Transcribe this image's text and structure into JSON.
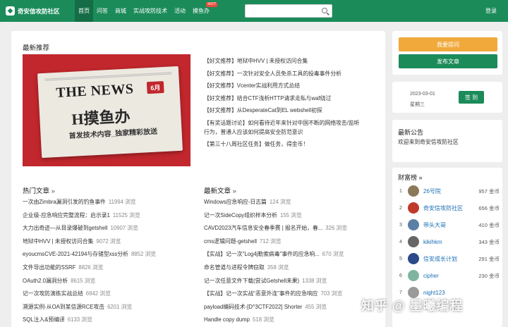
{
  "nav": {
    "logo": "奇安信攻防社区",
    "links": [
      "首页",
      "问答",
      "商城",
      "实战攻防技术",
      "活动",
      "摸鱼办"
    ],
    "hot_badge": "HOT",
    "search_placeholder": "",
    "login": "登录"
  },
  "recommend": {
    "title": "最新推荐",
    "banner": {
      "big": "THE NEWS",
      "month": "6月",
      "headline": "H摸鱼办",
      "sub": "首发技术内容_独家精彩放送"
    },
    "items": [
      "【好文推荐】地狱中HVV | 未授权访问合集",
      "【好文推荐】一次针对安全人员免杀工具的投毒事件分析",
      "【好文推荐】Vcenter实战利用方式总结",
      "【好文推荐】结合CTF浅析HTTP请求走私与waf绕过",
      "【好文推荐】从DesperateCat到EL webshell初探",
      "【有奖话题讨论】如何看待近年来针对中国不断的网络攻击/监听行为，普通人应该如何提高安全防范意识",
      "【第三十八周社区任务】做任务，得金币！"
    ]
  },
  "hot": {
    "title": "热门文章",
    "more": "»",
    "items": [
      {
        "title": "一次由Zimbra漏洞引发的钓鱼事件",
        "views": "11994 浏览"
      },
      {
        "title": "企业级-应急响应完整流程：启示录1",
        "views": "11525 浏览"
      },
      {
        "title": "大力出奇迹—从目录爆破到getshell",
        "views": "10907 浏览"
      },
      {
        "title": "地狱中HVV | 未授权访问合集",
        "views": "9072 浏览"
      },
      {
        "title": "eyoucmsCVE-2021-42194与存储型xss分析",
        "views": "8852 浏览"
      },
      {
        "title": "文件导出功能的SSRF",
        "views": "8826 浏览"
      },
      {
        "title": "OAuth2.0漏洞分析",
        "views": "8615 浏览"
      },
      {
        "title": "记一次攻防演练实战总结",
        "views": "6942 浏览"
      },
      {
        "title": "溯源实例-从OA到某信源RCE攻击",
        "views": "6201 浏览"
      },
      {
        "title": "SQL注入&预编译",
        "views": "6133 浏览"
      }
    ]
  },
  "latest": {
    "title": "最新文章",
    "more": "»",
    "items": [
      {
        "title": "Windows应急响应-日志篇",
        "views": "124 浏览"
      },
      {
        "title": "记一次SideCopy组织样本分析",
        "views": "155 浏览"
      },
      {
        "title": "CAVD2023汽车信息安全春季赛 | 报名开始，春...",
        "views": "326 浏览"
      },
      {
        "title": "cms逻辑问题-getshell",
        "views": "712 浏览"
      },
      {
        "title": "【实战】记一次\"Log4j勒索病毒\"事件的应急响...",
        "views": "670 浏览"
      },
      {
        "title": "命名管道与进程令牌窃取",
        "views": "358 浏览"
      },
      {
        "title": "记一次任意文件下载(尝试Getshell未果)",
        "views": "1338 浏览"
      },
      {
        "title": "【实战】记一次实战\"恶意外连\"事件的应急响应",
        "views": "703 浏览"
      },
      {
        "title": "payload编码技术-[D^3CTF2022] Shorter",
        "views": "455 浏览"
      },
      {
        "title": "Handle copy dump",
        "views": "518 浏览"
      }
    ]
  },
  "sidebar": {
    "ask_button": "我要提问",
    "post_button": "发布文章",
    "date": "2023-03-01",
    "weekday": "星期三",
    "signin": "签 到",
    "notice_title": "最新公告",
    "notice_text": "欢迎来到奇安信攻防社区",
    "rank_title": "财富榜 »",
    "rank": [
      {
        "num": "1",
        "name": "26号院",
        "coins": "957 金币",
        "color": "#8b7a5a"
      },
      {
        "num": "2",
        "name": "奇安信攻防社区",
        "coins": "656 金币",
        "color": "#c0392b"
      },
      {
        "num": "3",
        "name": "带头大哥",
        "coins": "410 金币",
        "color": "#5b7fa6"
      },
      {
        "num": "4",
        "name": "kikihkm",
        "coins": "343 金币",
        "color": "#666666"
      },
      {
        "num": "5",
        "name": "信安成长计划",
        "coins": "291 金币",
        "color": "#2a4a8a"
      },
      {
        "num": "6",
        "name": "cipher",
        "coins": "230 金币",
        "color": "#7fb5a0"
      },
      {
        "num": "7",
        "name": "night123",
        "coins": "",
        "color": "#9a9a9a"
      }
    ]
  },
  "watermark": "知乎 @ 墨曦编程"
}
